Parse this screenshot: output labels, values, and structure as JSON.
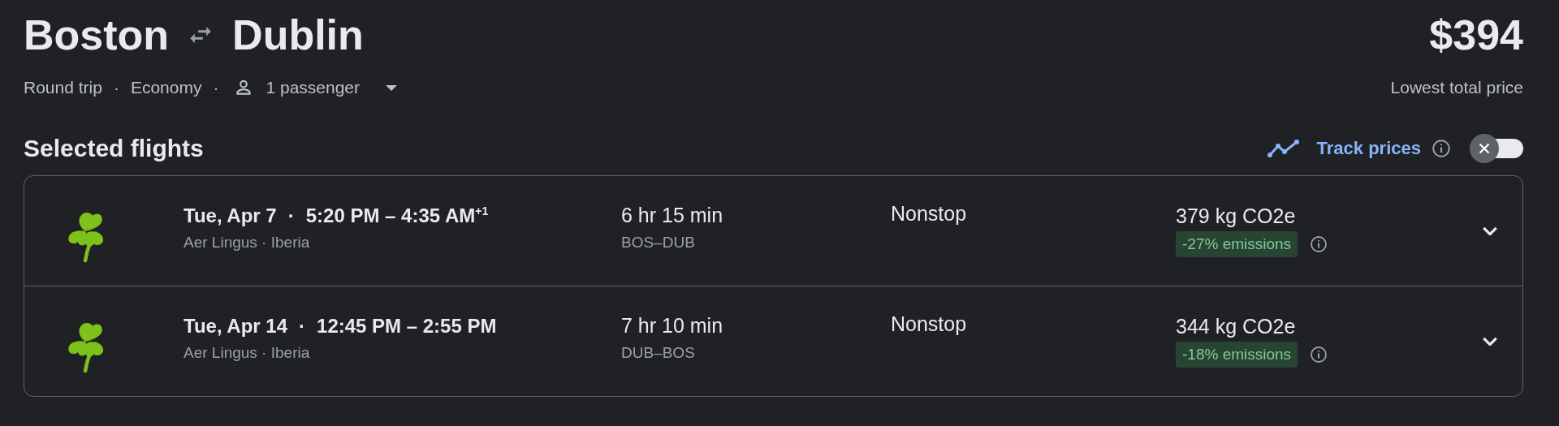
{
  "header": {
    "origin": "Boston",
    "destination": "Dublin",
    "price": "$394",
    "price_label": "Lowest total price"
  },
  "options": {
    "separator": "·",
    "trip_type": "Round trip",
    "cabin": "Economy",
    "passengers": "1 passenger"
  },
  "section": {
    "title": "Selected flights",
    "track_prices": {
      "label": "Track prices",
      "on": false
    }
  },
  "flights": [
    {
      "date": "Tue, Apr 7",
      "separator": "·",
      "times": "5:20 PM – 4:35 AM$^{+1}$",
      "airlines": "Aer Lingus · Iberia",
      "duration": "6 hr 15 min",
      "route": "BOS–DUB",
      "stops": "Nonstop",
      "emissions": "379 kg CO2e",
      "emissions_badge": "-27% emissions",
      "expanded": false
    },
    {
      "date": "Tue, Apr 14",
      "separator": "·",
      "times": "12:45 PM – 2:55 PM",
      "airlines": "Aer Lingus · Iberia",
      "duration": "7 hr 10 min",
      "route": "DUB–BOS",
      "stops": "Nonstop",
      "emissions": "344 kg CO2e",
      "emissions_badge": "-18% emissions",
      "expanded": false
    }
  ]
}
